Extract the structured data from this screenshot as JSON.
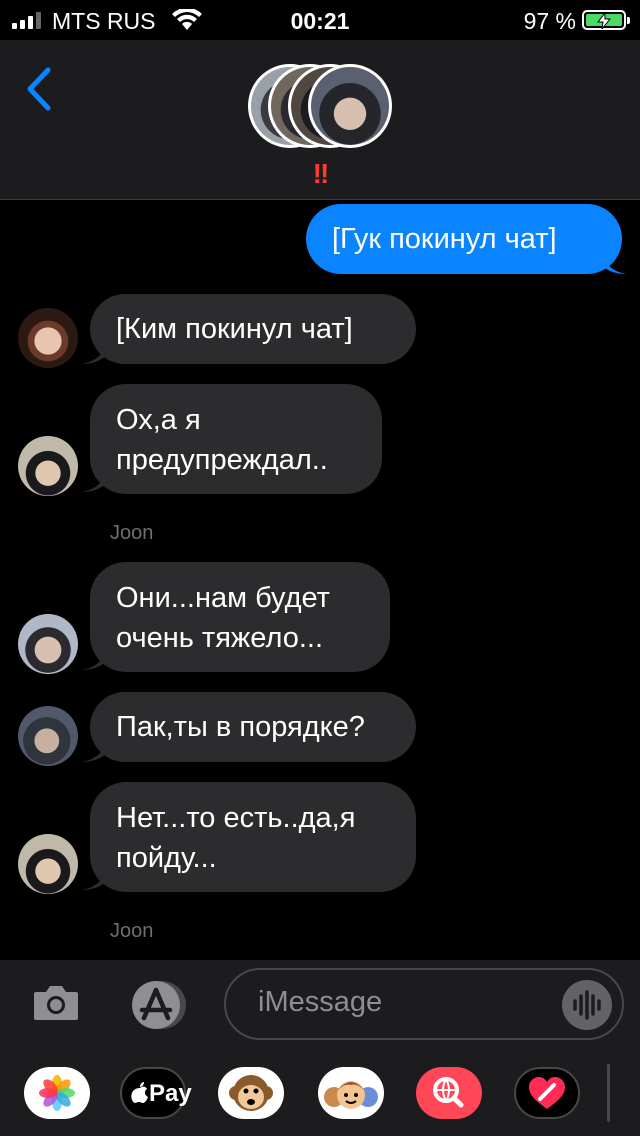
{
  "status_bar": {
    "carrier": "MTS RUS",
    "time": "00:21",
    "battery_percent": "97 %"
  },
  "header": {
    "alert_marks": "!!"
  },
  "messages": [
    {
      "direction": "out",
      "text": "[Гук покинул чат]"
    },
    {
      "direction": "in",
      "text": "[Ким покинул чат]"
    },
    {
      "direction": "in",
      "lines": [
        "Ох,а я",
        "предупреждал.."
      ]
    },
    {
      "direction": "in",
      "lines": [
        "Они...нам будет",
        "очень тяжело..."
      ]
    },
    {
      "direction": "in",
      "text": "Пак,ты в порядке?"
    },
    {
      "direction": "in",
      "lines": [
        "Нет...то есть..да,я",
        "пойду..."
      ]
    }
  ],
  "senders": [
    "Joon",
    "Joon"
  ],
  "input": {
    "placeholder": "iMessage"
  },
  "app_drawer": {
    "apple_pay_label": "Pay",
    "items": [
      "photos-icon",
      "apple-pay",
      "animoji-icon",
      "memoji-icon",
      "web-search-icon",
      "digital-touch-icon"
    ]
  },
  "colors": {
    "outgoing_bubble": "#0a84ff",
    "incoming_bubble": "#2c2c2e",
    "alert": "#ff3b30",
    "battery": "#4cd964"
  }
}
